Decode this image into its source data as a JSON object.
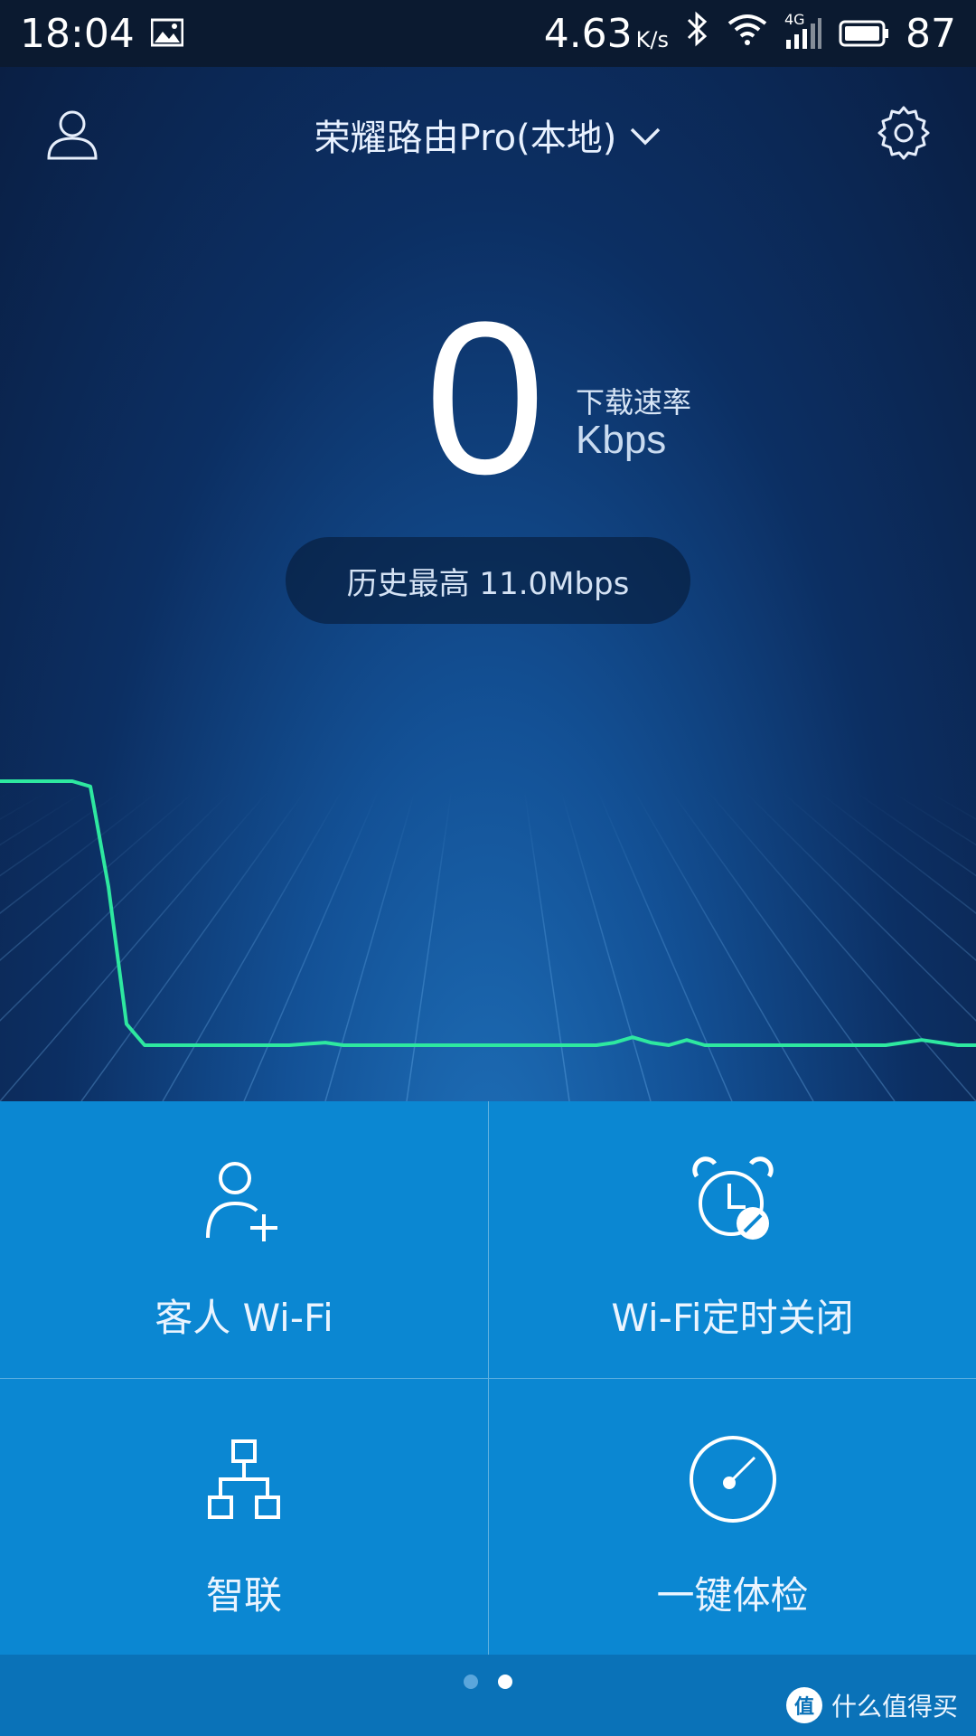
{
  "status_bar": {
    "time": "18:04",
    "net_speed": "4.63",
    "net_speed_unit": "K/s",
    "network_type": "4G",
    "battery": "87"
  },
  "header": {
    "router_name": "荣耀路由Pro(本地)"
  },
  "speed": {
    "value": "0",
    "label": "下载速率",
    "unit": "Kbps"
  },
  "history": {
    "text": "历史最高 11.0Mbps"
  },
  "chart_data": {
    "type": "line",
    "series": [
      {
        "values": [
          1.0,
          1.0,
          1.0,
          1.0,
          1.0,
          0.98,
          0.6,
          0.08,
          0.0,
          0.0,
          0.0,
          0.0,
          0.0,
          0.0,
          0.0,
          0.0,
          0.0,
          0.005,
          0.01,
          0.0,
          0.0,
          0.0,
          0.0,
          0.0,
          0.0,
          0.0,
          0.0,
          0.0,
          0.0,
          0.0,
          0.0,
          0.0,
          0.0,
          0.0,
          0.01,
          0.03,
          0.01,
          0.0,
          0.02,
          0.0,
          0.0,
          0.0,
          0.0,
          0.0,
          0.0,
          0.0,
          0.0,
          0.0,
          0.0,
          0.0,
          0.01,
          0.02,
          0.01,
          0.0,
          0.0
        ]
      }
    ],
    "line_color": "#2ee8a0"
  },
  "tiles": [
    {
      "label": "客人 Wi-Fi",
      "icon": "add-user-icon"
    },
    {
      "label": "Wi-Fi定时关闭",
      "icon": "alarm-clock-icon"
    },
    {
      "label": "智联",
      "icon": "network-topology-icon"
    },
    {
      "label": "一键体检",
      "icon": "gauge-icon"
    }
  ],
  "pager": {
    "count": 2,
    "active": 1
  },
  "watermark": {
    "badge": "值",
    "text": "什么值得买"
  },
  "colors": {
    "tile_bg": "#0b87d2",
    "dot_active": "#ffffff",
    "dot_inactive": "#5aa6dc"
  }
}
